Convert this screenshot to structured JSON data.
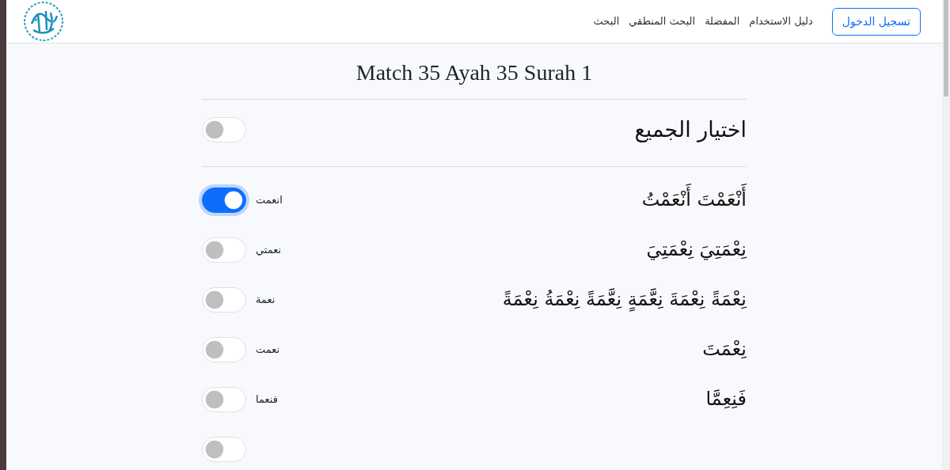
{
  "navbar": {
    "login_button": "تسجيل الدخول",
    "links": [
      "دليل الاستخدام",
      "المفضلة",
      "البحث المنطقي",
      "البحث"
    ]
  },
  "title": "Match 35 Ayah 35 Surah 1",
  "select_all": {
    "label": "اختيار الجميع",
    "checked": false
  },
  "matches": [
    {
      "text": "أَنْعَمْتَ أَنْعَمْتُ",
      "word": "انعمت",
      "checked": true
    },
    {
      "text": "نِعْمَتِيَ نِعْمَتِيَ",
      "word": "نعمتي",
      "checked": false
    },
    {
      "text": "نِعْمَةً نِعْمَةَ نِعَّمَةٍ نِعَّمَةً نِعْمَةُ نِعْمَةً",
      "word": "نعمة",
      "checked": false
    },
    {
      "text": "نِعْمَتَ",
      "word": "نعمت",
      "checked": false
    },
    {
      "text": "فَنِعِمَّا",
      "word": "فنعما",
      "checked": false
    },
    {
      "checked": false
    }
  ]
}
